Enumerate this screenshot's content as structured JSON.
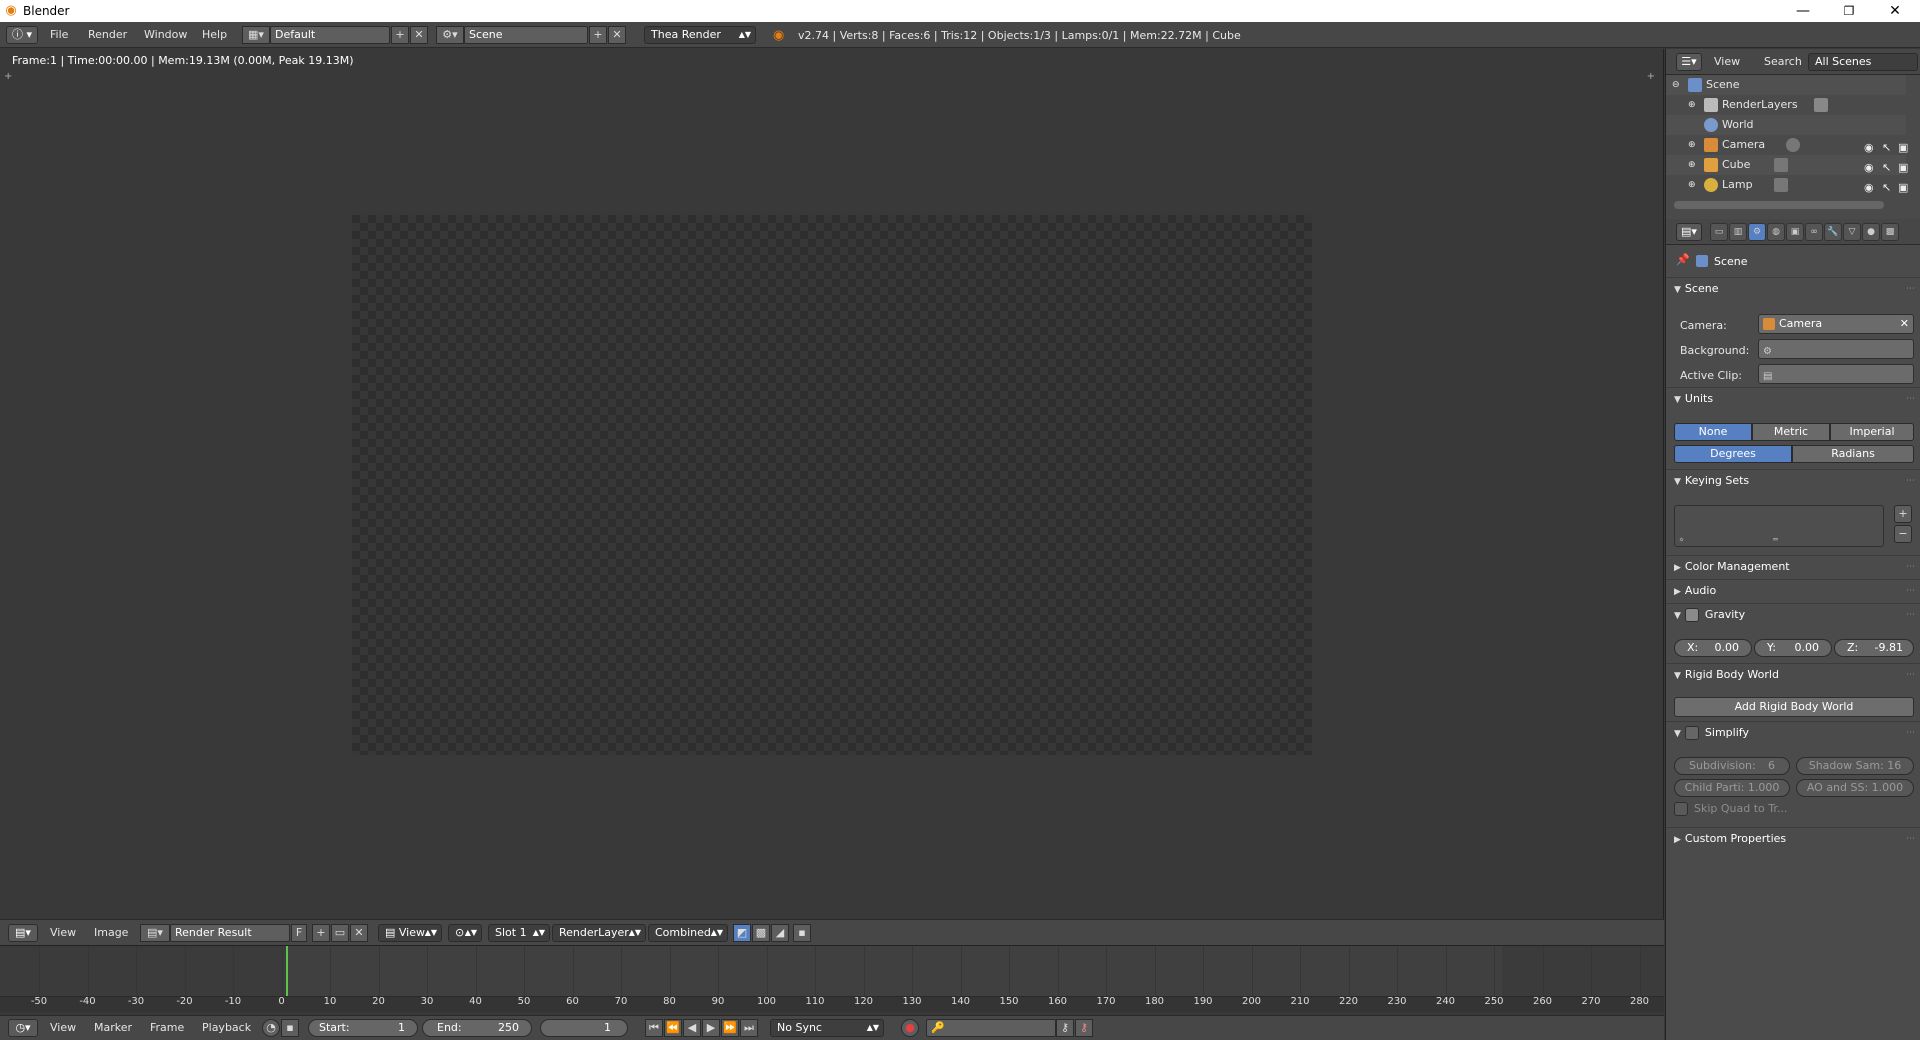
{
  "window": {
    "title": "Blender",
    "minimize": "—",
    "restore": "❐",
    "close": "✕"
  },
  "topbar": {
    "menus": [
      "File",
      "Render",
      "Window",
      "Help"
    ],
    "layout": "Default",
    "scene": "Scene",
    "engine": "Thea Render",
    "stats": "v2.74 | Verts:8 | Faces:6 | Tris:12 | Objects:1/3 | Lamps:0/1 | Mem:22.72M | Cube"
  },
  "image_editor": {
    "mem_info": "Frame:1 | Time:00:00.00 | Mem:19.13M (0.00M, Peak 19.13M)",
    "header": {
      "menus": [
        "View",
        "Image"
      ],
      "image_name": "Render Result",
      "fake_user": "F",
      "view_mode": "View",
      "slot": "Slot 1",
      "render_layer": "RenderLayer",
      "pass": "Combined"
    }
  },
  "timeline": {
    "ticks": [
      "-50",
      "-40",
      "-30",
      "-20",
      "-10",
      "0",
      "10",
      "20",
      "30",
      "40",
      "50",
      "60",
      "70",
      "80",
      "90",
      "100",
      "110",
      "120",
      "130",
      "140",
      "150",
      "160",
      "170",
      "180",
      "190",
      "200",
      "210",
      "220",
      "230",
      "240",
      "250",
      "260",
      "270",
      "280"
    ],
    "header": {
      "menus": [
        "View",
        "Marker",
        "Frame",
        "Playback"
      ],
      "start_label": "Start:",
      "start_value": "1",
      "end_label": "End:",
      "end_value": "250",
      "current_frame": "1",
      "sync": "No Sync"
    }
  },
  "outliner": {
    "header": {
      "view": "View",
      "search": "Search",
      "filter": "All Scenes"
    },
    "items": [
      {
        "label": "Scene",
        "color": "#6a8fc9"
      },
      {
        "label": "RenderLayers",
        "color": "#bbbbbb"
      },
      {
        "label": "World",
        "color": "#7a9acb"
      },
      {
        "label": "Camera",
        "color": "#d88c3a"
      },
      {
        "label": "Cube",
        "color": "#e0a040"
      },
      {
        "label": "Lamp",
        "color": "#d8b040"
      }
    ]
  },
  "properties": {
    "context": "Scene",
    "panels": {
      "scene": "Scene",
      "units": "Units",
      "keying_sets": "Keying Sets",
      "color_management": "Color Management",
      "audio": "Audio",
      "gravity": "Gravity",
      "rigid_body_world": "Rigid Body World",
      "simplify": "Simplify",
      "custom_properties": "Custom Properties"
    },
    "scene_panel": {
      "camera_label": "Camera:",
      "camera_value": "Camera",
      "background_label": "Background:",
      "active_clip_label": "Active Clip:"
    },
    "units_panel": {
      "systems": [
        "None",
        "Metric",
        "Imperial"
      ],
      "active_system": "None",
      "rotation": [
        "Degrees",
        "Radians"
      ],
      "active_rotation": "Degrees"
    },
    "gravity_panel": {
      "x_label": "X:",
      "x_value": "0.00",
      "y_label": "Y:",
      "y_value": "0.00",
      "z_label": "Z:",
      "z_value": "-9.81"
    },
    "rigid_body_panel": {
      "button": "Add Rigid Body World"
    },
    "simplify_panel": {
      "subdivision_label": "Subdivision:",
      "subdivision_value": "6",
      "shadow_label": "Shadow Sam: 16",
      "child_label": "Child Parti: 1.000",
      "ao_label": "AO and SS: 1.000",
      "skip_quad": "Skip Quad to Tr..."
    }
  }
}
